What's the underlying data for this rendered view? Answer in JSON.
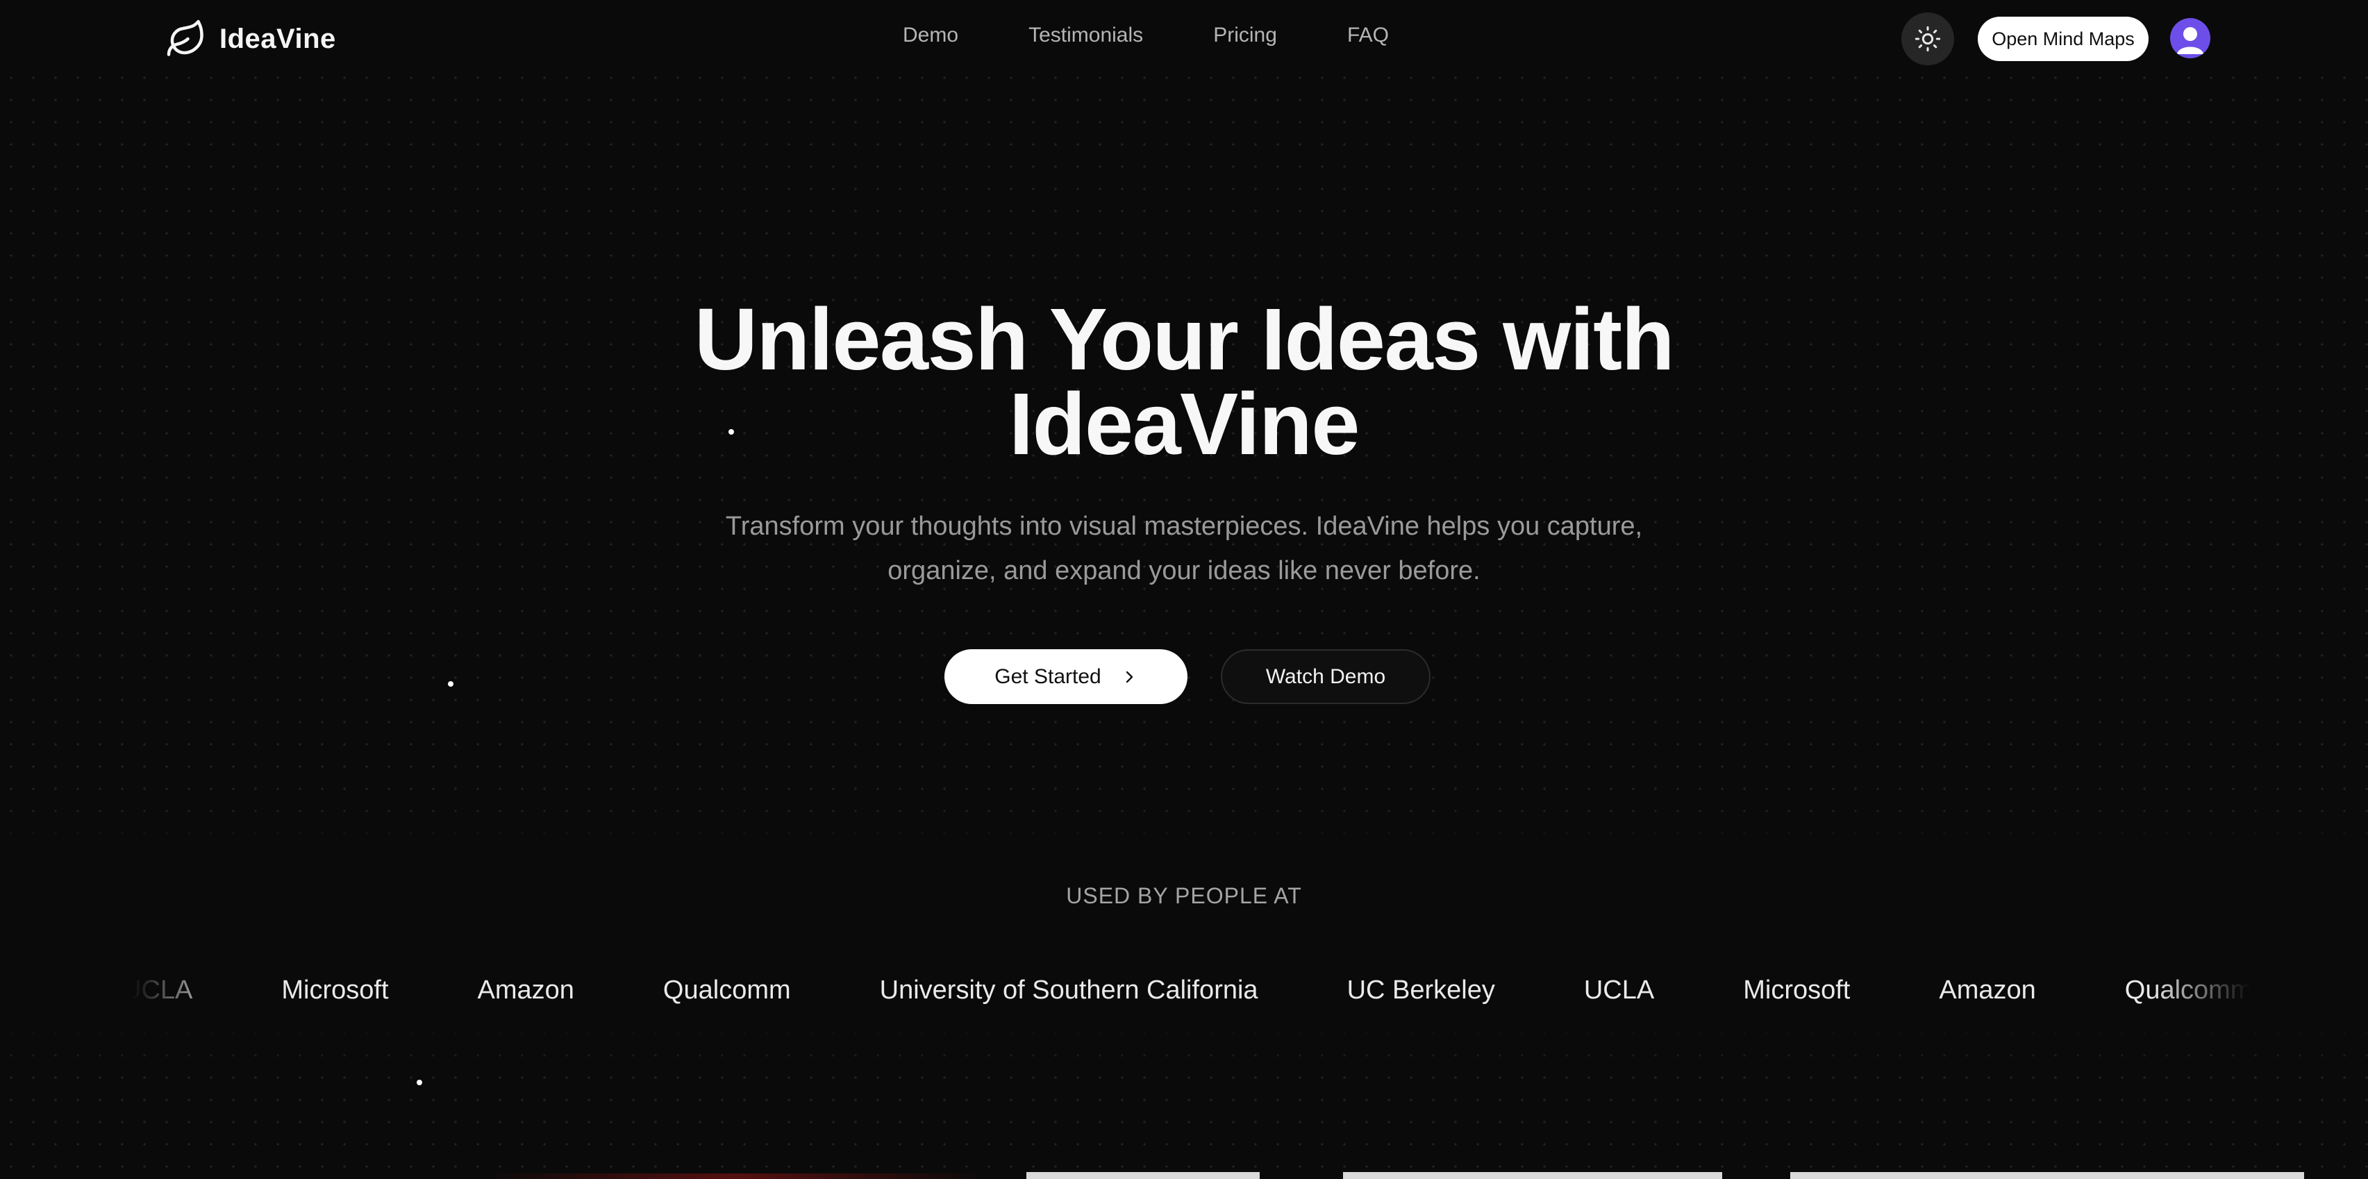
{
  "nav": {
    "brand": "IdeaVine",
    "links": [
      "Demo",
      "Testimonials",
      "Pricing",
      "FAQ"
    ],
    "open_label": "Open Mind Maps"
  },
  "hero": {
    "title_line1": "Unleash Your Ideas with",
    "title_line2": "IdeaVine",
    "subtitle_line1": "Transform your thoughts into visual masterpieces. IdeaVine helps you capture,",
    "subtitle_line2": "organize, and expand your ideas like never before.",
    "primary_cta": "Get Started",
    "secondary_cta": "Watch Demo"
  },
  "used_by": {
    "label": "USED BY PEOPLE AT",
    "logos": [
      "UCLA",
      "Microsoft",
      "Amazon",
      "Qualcomm",
      "University of Southern California",
      "UC Berkeley",
      "UCLA",
      "Microsoft",
      "Amazon",
      "Qualcomm"
    ]
  },
  "icons": {
    "brand": "leaf-icon",
    "theme": "sun-icon",
    "arrow": "chevron-right-icon",
    "avatar": "user-avatar-icon"
  },
  "colors": {
    "background": "#0a0a0a",
    "avatar": "#6d4ee8",
    "primary_button": "#ffffff"
  }
}
